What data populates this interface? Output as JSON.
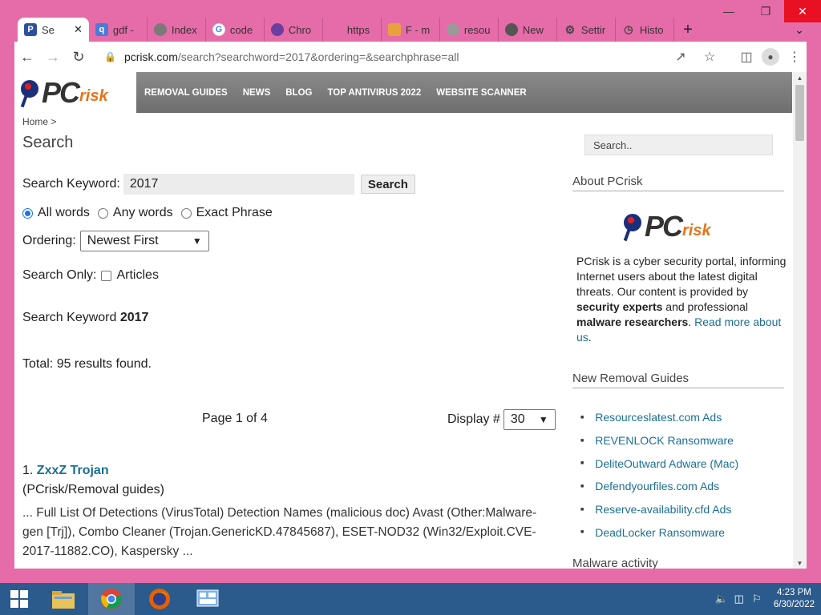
{
  "browser": {
    "tabs": [
      {
        "label": "Se",
        "icon": "pcrisk-favicon",
        "color": "#2c4fa0",
        "active": true
      },
      {
        "label": "gdf -",
        "icon": "search-favicon",
        "color": "#4a7bd6"
      },
      {
        "label": "Index",
        "icon": "globe-favicon",
        "color": "#7a7a7a"
      },
      {
        "label": "code",
        "icon": "google-favicon",
        "color": "#4285f4"
      },
      {
        "label": "Chro",
        "icon": "brave-favicon",
        "color": "#6b3fa0"
      },
      {
        "label": "https",
        "icon": "",
        "color": ""
      },
      {
        "label": "F - m",
        "icon": "flag-favicon",
        "color": "#e9a23b"
      },
      {
        "label": "resou",
        "icon": "globe-favicon",
        "color": "#9a9a9a"
      },
      {
        "label": "New",
        "icon": "chrome-favicon",
        "color": "#555555"
      },
      {
        "label": "Settir",
        "icon": "gear-favicon",
        "color": "#555555"
      },
      {
        "label": "Histo",
        "icon": "history-favicon",
        "color": "#555555"
      }
    ],
    "url_host": "pcrisk.com",
    "url_path": "/search?searchword=2017&ordering=&searchphrase=all"
  },
  "site": {
    "logo_pc": "PC",
    "logo_risk": "risk",
    "nav": [
      "REMOVAL GUIDES",
      "NEWS",
      "BLOG",
      "TOP ANTIVIRUS 2022",
      "WEBSITE SCANNER"
    ]
  },
  "page": {
    "breadcrumb": "Home >",
    "title": "Search",
    "keyword_label": "Search Keyword:",
    "keyword_value": "2017",
    "search_button": "Search",
    "radio_all": "All words",
    "radio_any": "Any words",
    "radio_exact": "Exact Phrase",
    "ordering_label": "Ordering:",
    "ordering_value": "Newest First",
    "search_only_label": "Search Only:",
    "articles_label": "Articles",
    "keyword_summary_prefix": "Search Keyword",
    "keyword_summary_value": "2017",
    "total": "Total: 95 results found.",
    "page_info": "Page 1 of 4",
    "display_label": "Display #",
    "display_value": "30",
    "result": {
      "number": "1.",
      "title": "ZxxZ Trojan",
      "category": "(PCrisk/Removal guides)",
      "snippet": "... Full List Of Detections (VirusTotal) Detection Names (malicious doc) Avast (Other:Malware-gen [Trj]), Combo Cleaner (Trojan.GenericKD.47845687), ESET-NOD32 (Win32/Exploit.CVE-2017-11882.CO), Kaspersky ..."
    }
  },
  "sidebar": {
    "search_placeholder": "Search..",
    "about_heading": "About PCrisk",
    "about_p1": "PCrisk is a cyber security portal, informing Internet users about the latest digital threats. Our content is provided by ",
    "about_b1": "security experts",
    "about_p2": " and professional ",
    "about_b2": "malware researchers",
    "about_p3": ". ",
    "about_link": "Read more about us",
    "about_end": ".",
    "guides_heading": "New Removal Guides",
    "guides": [
      "Resourceslatest.com Ads",
      "REVENLOCK Ransomware",
      "DeliteOutward Adware (Mac)",
      "Defendyourfiles.com Ads",
      "Reserve-availability.cfd Ads",
      "DeadLocker Ransomware"
    ],
    "malware_heading": "Malware activity"
  },
  "taskbar": {
    "time": "4:23 PM",
    "date": "6/30/2022"
  },
  "colors": {
    "window_frame": "#e56ca8",
    "link": "#1b6f93",
    "taskbar": "#2b5a8c",
    "close_button": "#e81123"
  }
}
